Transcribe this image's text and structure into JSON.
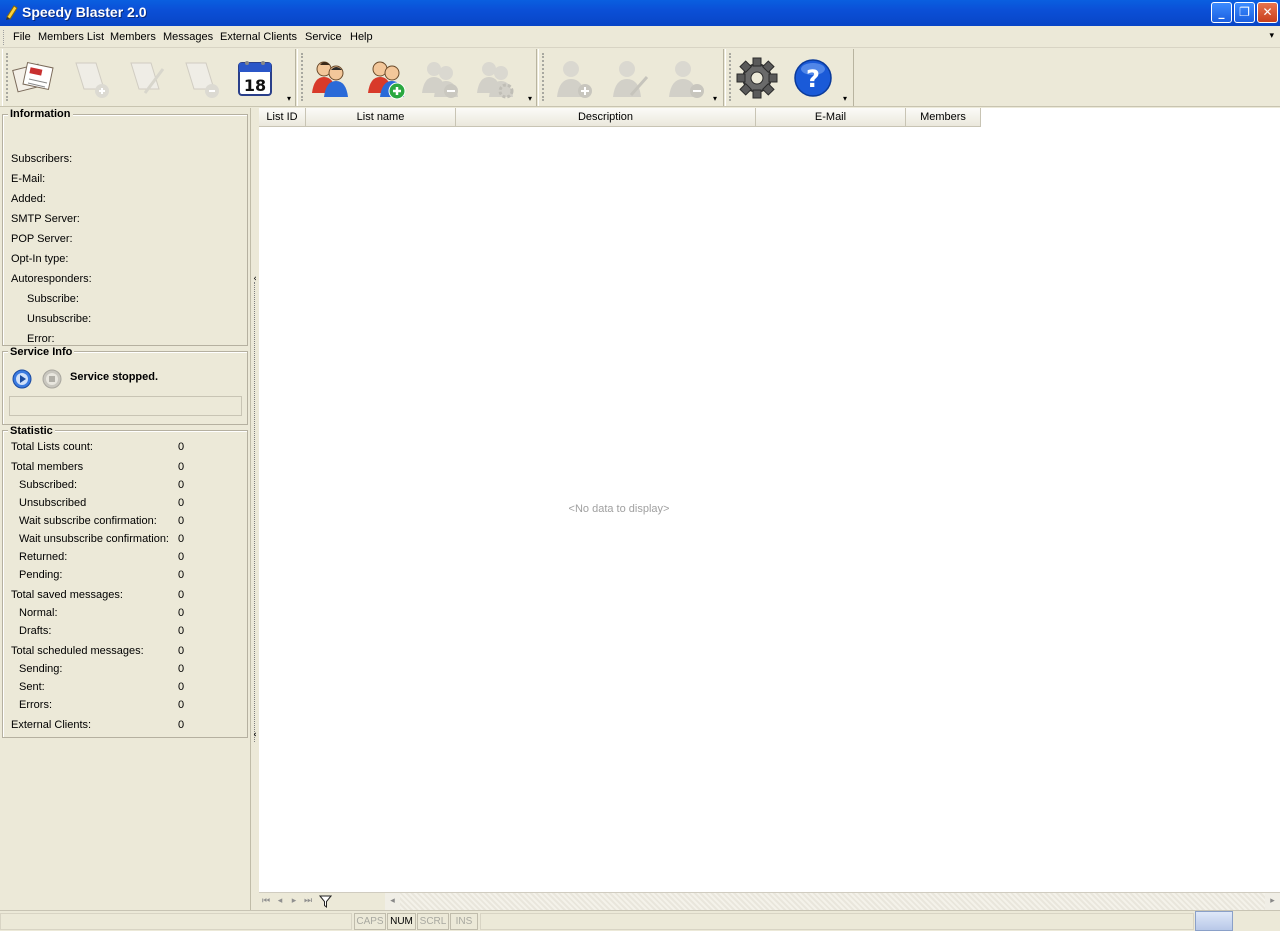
{
  "window": {
    "title": "Speedy Blaster 2.0"
  },
  "menu": [
    "File",
    "Members List",
    "Members",
    "Messages",
    "External Clients",
    "Service",
    "Help"
  ],
  "information": {
    "title": "Information",
    "fields": [
      "Subscribers:",
      "E-Mail:",
      "Added:",
      "SMTP Server:",
      "POP Server:",
      "Opt-In type:",
      "Autoresponders:",
      "Subscribe:",
      "Unsubscribe:",
      "Error:"
    ]
  },
  "service": {
    "title": "Service Info",
    "status": "Service stopped."
  },
  "statistic": {
    "title": "Statistic",
    "rows": [
      {
        "label": "Total Lists count:",
        "value": "0"
      },
      {
        "label": "Total members",
        "value": "0"
      },
      {
        "label": "Subscribed:",
        "value": "0"
      },
      {
        "label": "Unsubscribed",
        "value": "0"
      },
      {
        "label": "Wait subscribe confirmation:",
        "value": "0"
      },
      {
        "label": "Wait unsubscribe confirmation:",
        "value": "0"
      },
      {
        "label": "Returned:",
        "value": "0"
      },
      {
        "label": "Pending:",
        "value": "0"
      },
      {
        "label": "Total saved messages:",
        "value": "0"
      },
      {
        "label": "Normal:",
        "value": "0"
      },
      {
        "label": "Drafts:",
        "value": "0"
      },
      {
        "label": "Total scheduled messages:",
        "value": "0"
      },
      {
        "label": "Sending:",
        "value": "0"
      },
      {
        "label": "Sent:",
        "value": "0"
      },
      {
        "label": "Errors:",
        "value": "0"
      },
      {
        "label": "External Clients:",
        "value": "0"
      }
    ]
  },
  "grid": {
    "columns": [
      "List ID",
      "List name",
      "Description",
      "E-Mail",
      "Members"
    ],
    "empty_text": "<No data to display>"
  },
  "statusbar": {
    "caps": "CAPS",
    "num": "NUM",
    "scrl": "SCRL",
    "ins": "INS"
  },
  "toolbar": {
    "calendar_day": "18"
  }
}
